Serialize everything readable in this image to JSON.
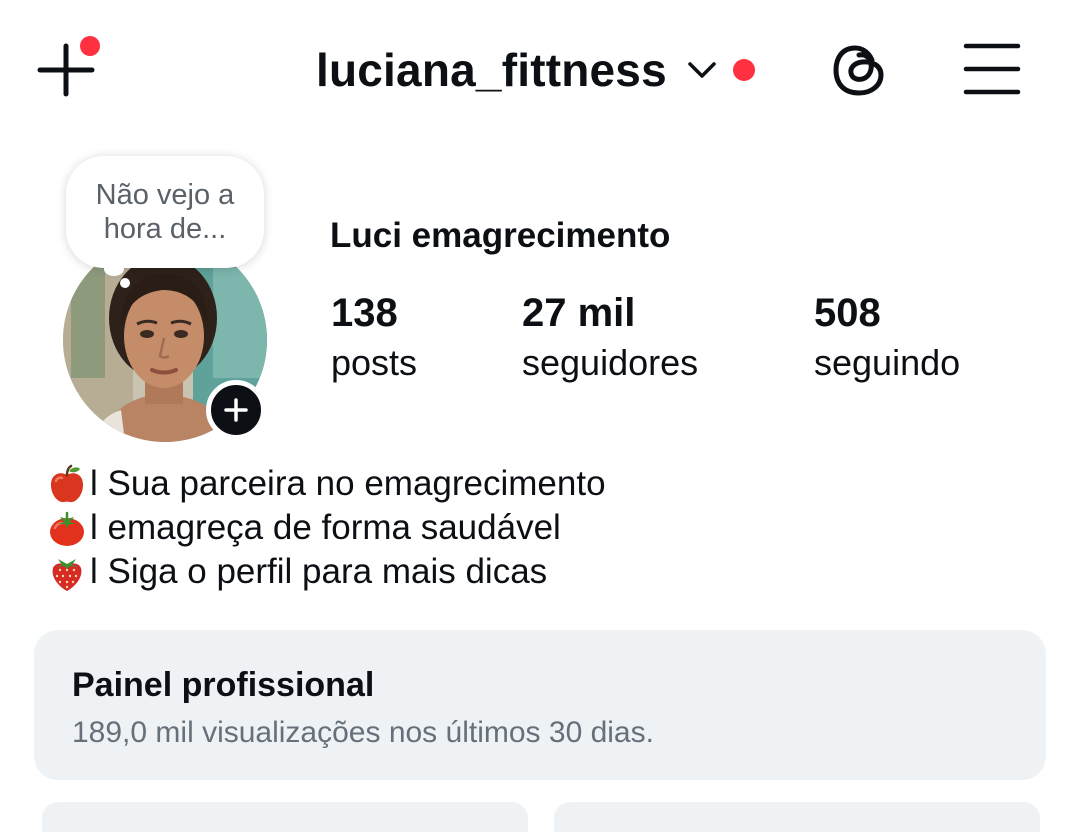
{
  "header": {
    "username": "luciana_fittness",
    "create_icon": "plus-icon",
    "switch_icon": "chevron-down-icon",
    "threads_icon": "threads-icon",
    "menu_icon": "hamburger-menu-icon",
    "notification_color": "#ff3040"
  },
  "profile": {
    "note": "Não vejo a hora de...",
    "display_name": "Luci emagrecimento",
    "stats": {
      "posts_value": "138",
      "posts_label": "posts",
      "followers_value": "27 mil",
      "followers_label": "seguidores",
      "following_value": "508",
      "following_label": "seguindo"
    },
    "add_story_icon": "plus-icon"
  },
  "bio": {
    "lines": [
      {
        "icon": "apple-emoji",
        "text": "l Sua parceira no emagrecimento"
      },
      {
        "icon": "tomato-emoji",
        "text": "l emagreça de forma saudável"
      },
      {
        "icon": "strawberry-emoji",
        "text": "l Siga o perfil para mais dicas"
      }
    ]
  },
  "dashboard": {
    "title": "Painel profissional",
    "subtitle": "189,0 mil visualizações nos últimos 30 dias."
  },
  "colors": {
    "text": "#0c1014",
    "muted": "#66707a",
    "card_bg": "#eff2f5",
    "notification": "#ff3040"
  }
}
